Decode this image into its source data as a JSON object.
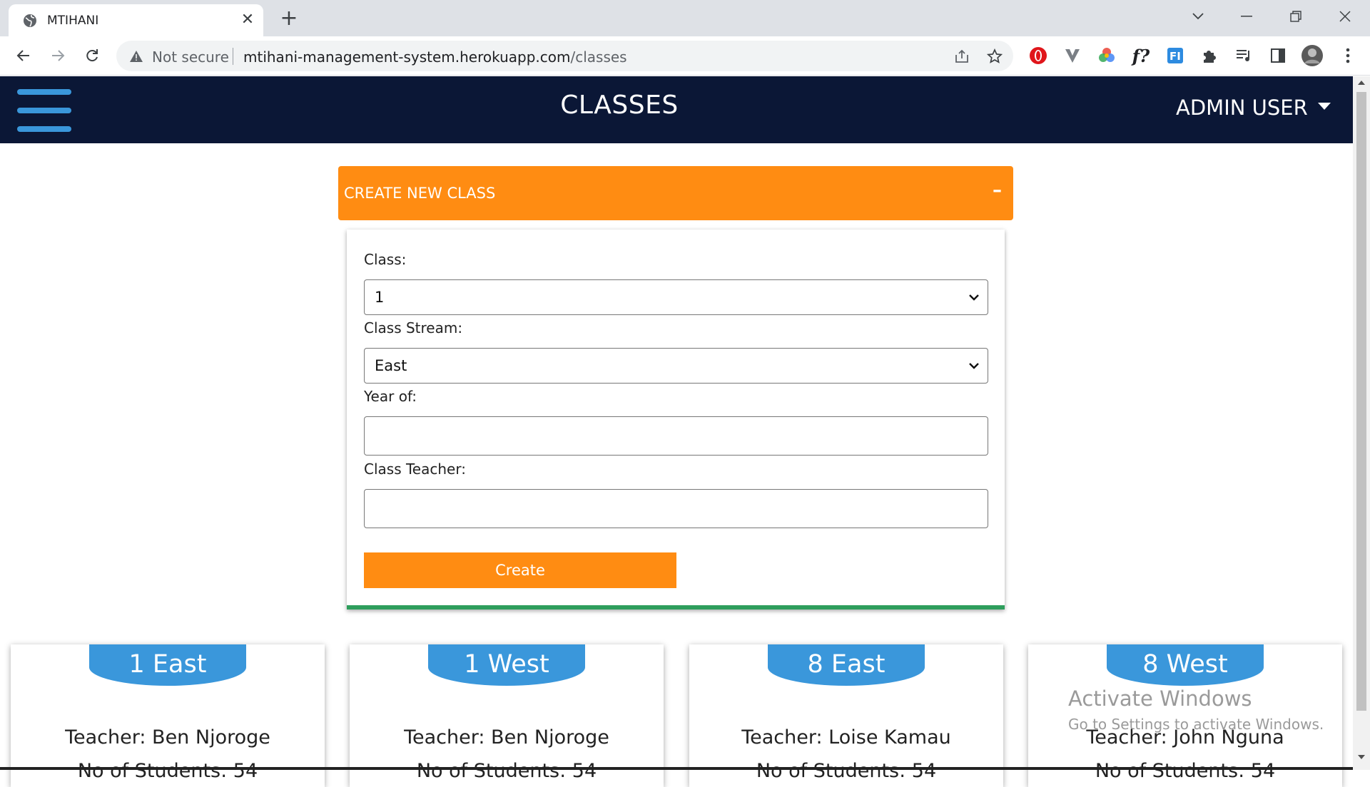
{
  "browser": {
    "tab_title": "MTIHANI",
    "security_label": "Not secure",
    "url_host": "mtihani-management-system.herokuapp.com",
    "url_path": "/classes",
    "extensions": [
      "opera-icon",
      "vivaldi-icon",
      "color-wheel-icon",
      "function-icon",
      "fi-icon",
      "puzzle-icon",
      "media-icon",
      "sidebar-icon",
      "profile-avatar"
    ]
  },
  "header": {
    "title": "CLASSES",
    "user_label": "ADMIN USER"
  },
  "create_panel": {
    "title": "CREATE NEW CLASS",
    "toggle": "–",
    "class_label": "Class:",
    "class_value": "1",
    "stream_label": "Class Stream:",
    "stream_value": "East",
    "year_label": "Year of:",
    "year_value": "",
    "teacher_label": "Class Teacher:",
    "teacher_value": "",
    "submit_label": "Create"
  },
  "classes": [
    {
      "name": "1 East",
      "teacher": "Teacher: Ben Njoroge",
      "students": "No of Students: 54"
    },
    {
      "name": "1 West",
      "teacher": "Teacher: Ben Njoroge",
      "students": "No of Students: 54"
    },
    {
      "name": "8 East",
      "teacher": "Teacher: Loise Kamau",
      "students": "No of Students: 54"
    },
    {
      "name": "8 West",
      "teacher": "Teacher: John Nguna",
      "students": "No of Students: 54"
    }
  ],
  "watermark": {
    "title": "Activate Windows",
    "subtitle": "Go to Settings to activate Windows."
  },
  "colors": {
    "header_bg": "#0b1736",
    "accent_orange": "#ff8c12",
    "accent_blue": "#3a97db",
    "accent_green": "#2e9e5c"
  }
}
